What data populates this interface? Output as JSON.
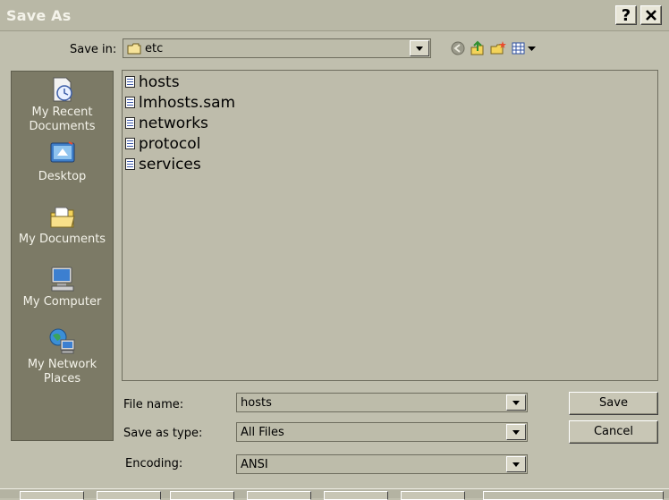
{
  "window": {
    "title": "Save As",
    "help_label": "?",
    "close_label": "✕"
  },
  "save_in": {
    "label": "Save in:",
    "value": "etc"
  },
  "toolbar_icons": [
    "back-icon",
    "up-folder-icon",
    "new-folder-icon",
    "views-menu-icon"
  ],
  "places": [
    {
      "label": "My Recent Documents",
      "icon": "recent-documents-icon"
    },
    {
      "label": "Desktop",
      "icon": "desktop-icon"
    },
    {
      "label": "My Documents",
      "icon": "my-documents-icon"
    },
    {
      "label": "My Computer",
      "icon": "my-computer-icon"
    },
    {
      "label": "My Network Places",
      "icon": "network-places-icon"
    }
  ],
  "files": [
    "hosts",
    "lmhosts.sam",
    "networks",
    "protocol",
    "services"
  ],
  "form": {
    "file_name_label": "File name:",
    "file_name_value": "hosts",
    "save_as_type_label": "Save as type:",
    "save_as_type_value": "All Files",
    "encoding_label": "Encoding:",
    "encoding_value": "ANSI"
  },
  "buttons": {
    "save": "Save",
    "cancel": "Cancel"
  },
  "colors": {
    "dialog_bg": "#c0bfae",
    "places_bar": "#7c7a66",
    "title_text": "#f4f3ea"
  }
}
